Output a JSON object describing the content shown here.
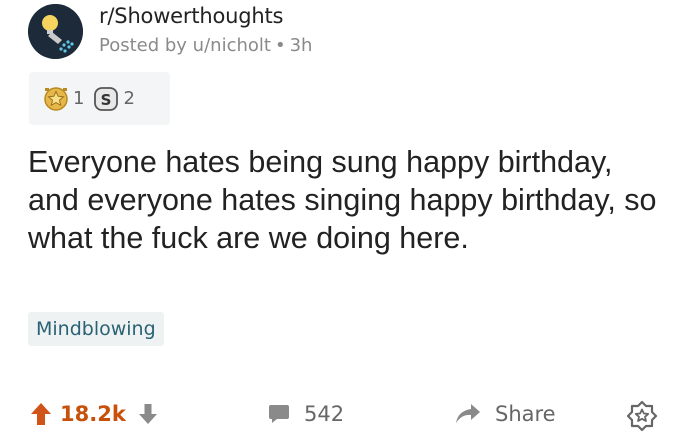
{
  "post": {
    "subreddit": "r/Showerthoughts",
    "posted_by": "Posted by u/nicholt",
    "time": "3h",
    "awards": [
      {
        "name": "Silver",
        "count": "1",
        "icon": "silver-award-icon"
      },
      {
        "name": "Gold",
        "count": "2",
        "icon": "gold-award-icon"
      }
    ],
    "title": "Everyone hates being sung happy birthday, and everyone hates singing happy birthday, so what the fuck are we doing here.",
    "flair": "Mindblowing"
  },
  "actions": {
    "score": "18.2k",
    "comments": "542",
    "share_label": "Share"
  },
  "colors": {
    "upvote": "#d0531a",
    "score": "#c8500a",
    "flair_bg": "#eef2f3",
    "flair_text": "#2a6273",
    "meta_text": "#8a8a8a"
  }
}
